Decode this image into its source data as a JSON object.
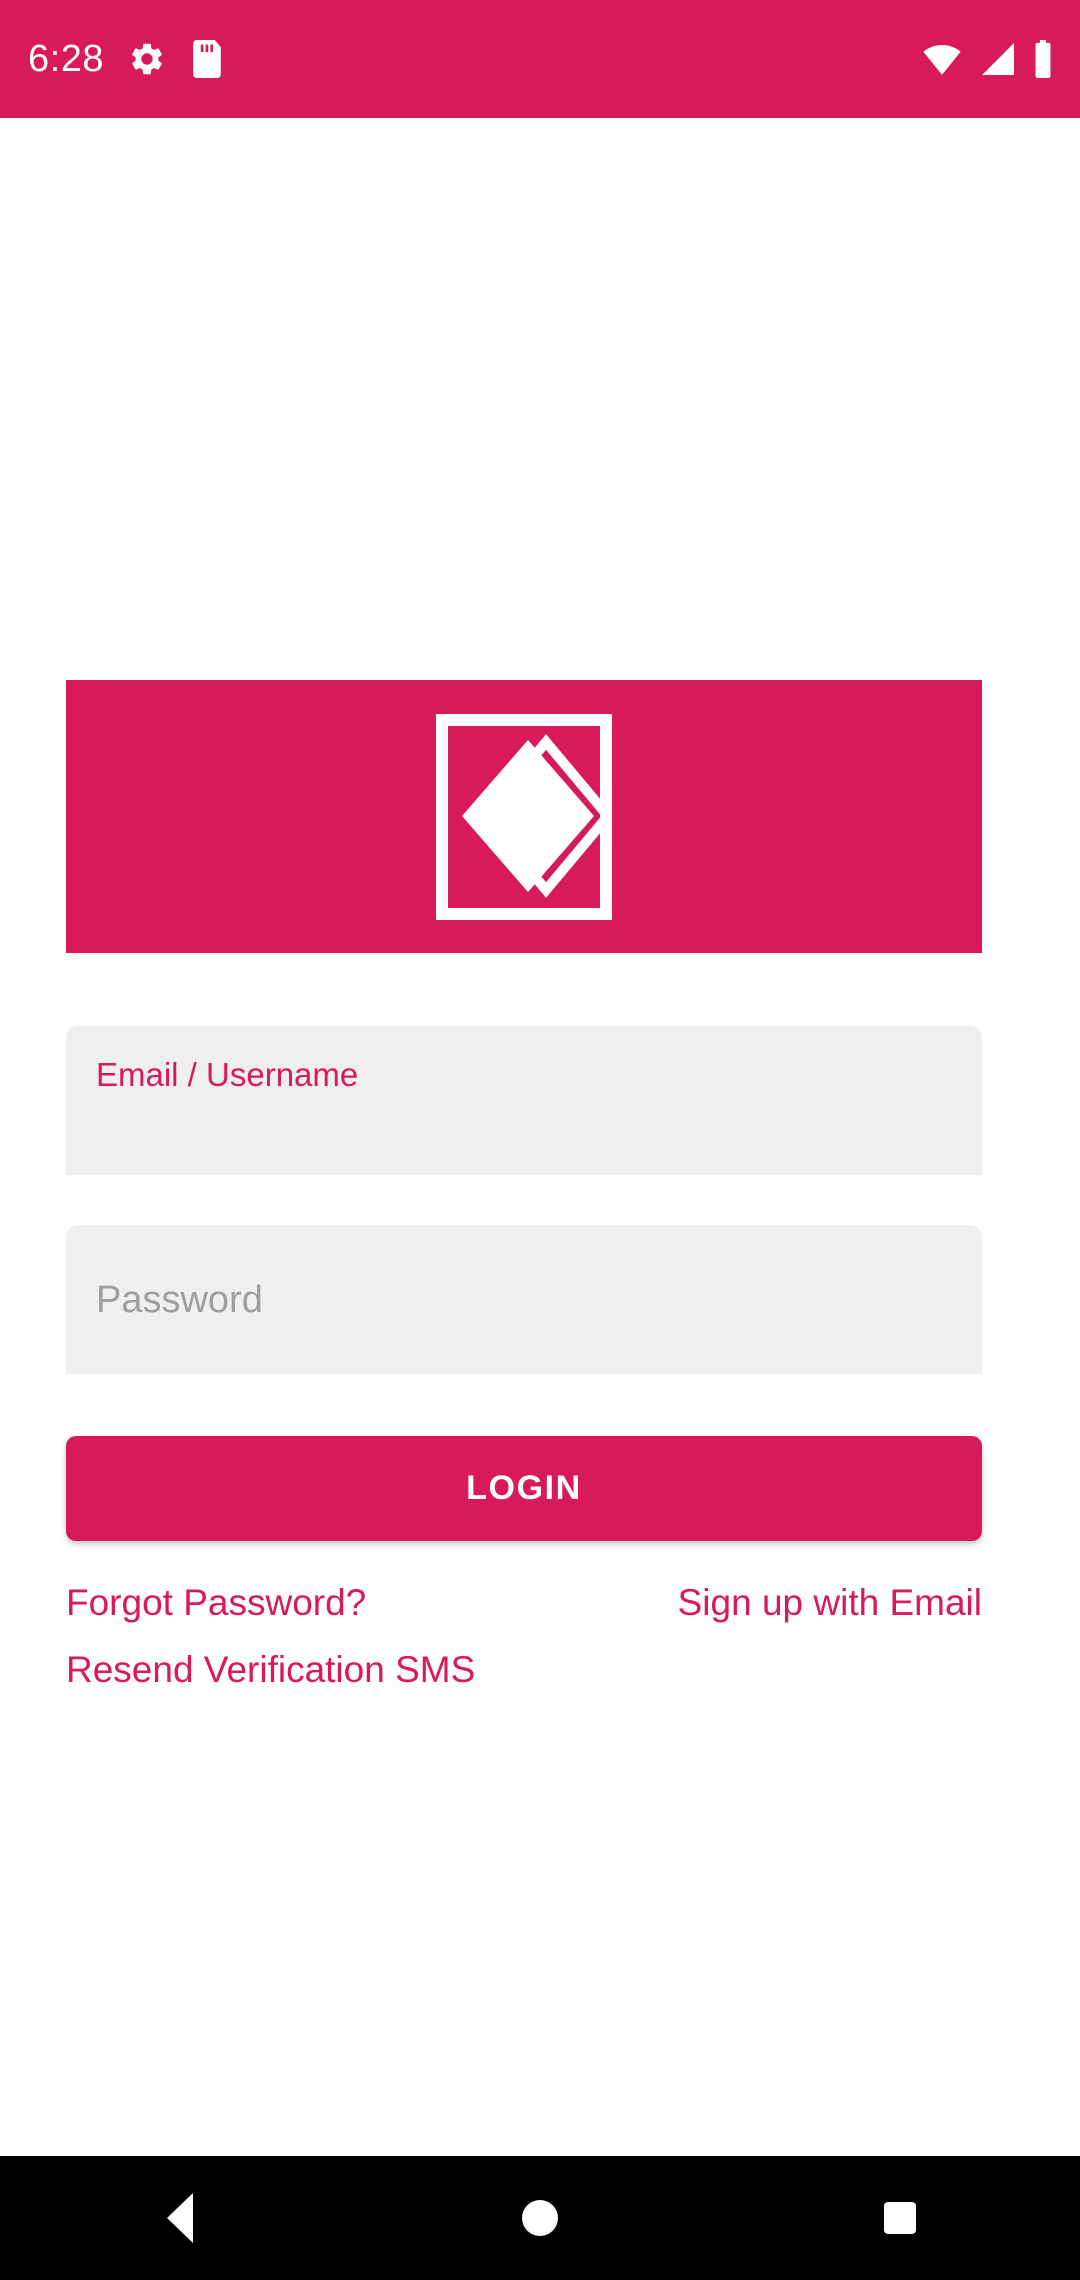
{
  "status_bar": {
    "time": "6:28",
    "background_color": "#d8195b",
    "foreground_color": "#ffffff",
    "left_icons": [
      "settings-gear-icon",
      "sd-card-icon"
    ],
    "right_icons": [
      "wifi-icon",
      "cellular-signal-icon",
      "battery-full-icon"
    ]
  },
  "app": {
    "accent_color": "#d8195b",
    "field_background_color": "#efefef"
  },
  "logo": {
    "alt": "app-logo-diamond-in-square",
    "background_color": "#d8195b",
    "mark_color": "#ffffff"
  },
  "form": {
    "email_field": {
      "label": "Email / Username",
      "value": "",
      "placeholder": "Email / Username"
    },
    "password_field": {
      "label": "Password",
      "value": "",
      "placeholder": "Password"
    },
    "login_button": {
      "label": "LOGIN"
    }
  },
  "links": {
    "forgot_password": "Forgot Password?",
    "sign_up_with_email": "Sign up with Email",
    "resend_verification_sms": "Resend Verification SMS"
  },
  "navigation_bar": {
    "background_color": "#000000",
    "back": "back-button",
    "home": "home-button",
    "recents": "recents-button"
  }
}
